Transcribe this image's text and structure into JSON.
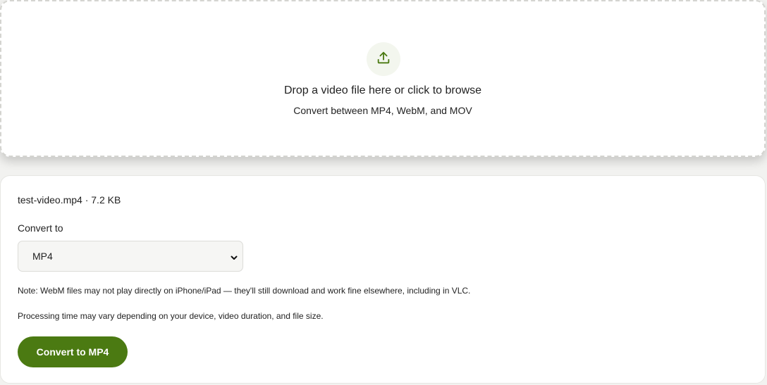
{
  "dropzone": {
    "icon": "upload-icon",
    "title": "Drop a video file here or click to browse",
    "subtitle": "Convert between MP4, WebM, and MOV"
  },
  "file": {
    "info": "test-video.mp4 · 7.2 KB"
  },
  "convert": {
    "label": "Convert to",
    "selected": "MP4",
    "options": [
      "MP4"
    ]
  },
  "notes": {
    "webm": "Note: WebM files may not play directly on iPhone/iPad — they'll still download and work fine elsewhere, including in VLC.",
    "processing": "Processing time may vary depending on your device, video duration, and file size."
  },
  "action": {
    "button_label": "Convert to MP4"
  },
  "colors": {
    "accent": "#4b7a12",
    "icon": "#4b7a12"
  }
}
